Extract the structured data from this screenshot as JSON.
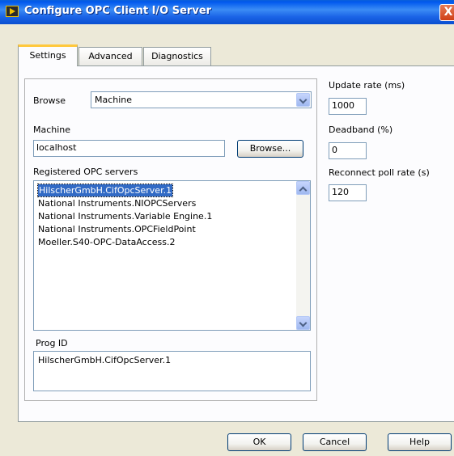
{
  "window": {
    "title": "Configure OPC Client I/O Server",
    "close_glyph": "X"
  },
  "tabs": [
    {
      "label": "Settings",
      "active": true
    },
    {
      "label": "Advanced",
      "active": false
    },
    {
      "label": "Diagnostics",
      "active": false
    }
  ],
  "settings": {
    "browse_label": "Browse",
    "browse_mode": "Machine",
    "machine_label": "Machine",
    "machine_value": "localhost",
    "browse_button": "Browse...",
    "registered_label": "Registered OPC servers",
    "servers": [
      "HilscherGmbH.CifOpcServer.1",
      "National Instruments.NIOPCServers",
      "National Instruments.Variable Engine.1",
      "National Instruments.OPCFieldPoint",
      "Moeller.S40-OPC-DataAccess.2"
    ],
    "selected_index": 0,
    "progid_label": "Prog ID",
    "progid_value": "HilscherGmbH.CifOpcServer.1"
  },
  "rates": {
    "update_label": "Update rate (ms)",
    "update_value": "1000",
    "deadband_label": "Deadband (%)",
    "deadband_value": "0",
    "reconnect_label": "Reconnect poll rate (s)",
    "reconnect_value": "120"
  },
  "buttons": {
    "ok": "OK",
    "cancel": "Cancel",
    "help": "Help"
  },
  "icons": {
    "app": "labview-icon",
    "close": "close-icon",
    "dropdown": "chevron-down-icon",
    "scroll_up": "chevron-up-icon",
    "scroll_down": "chevron-down-icon"
  },
  "colors": {
    "titlebar": "#0058ee",
    "selection": "#316ac5",
    "active_tab_accent": "#ffc83c",
    "close_button": "#cf3f17"
  }
}
